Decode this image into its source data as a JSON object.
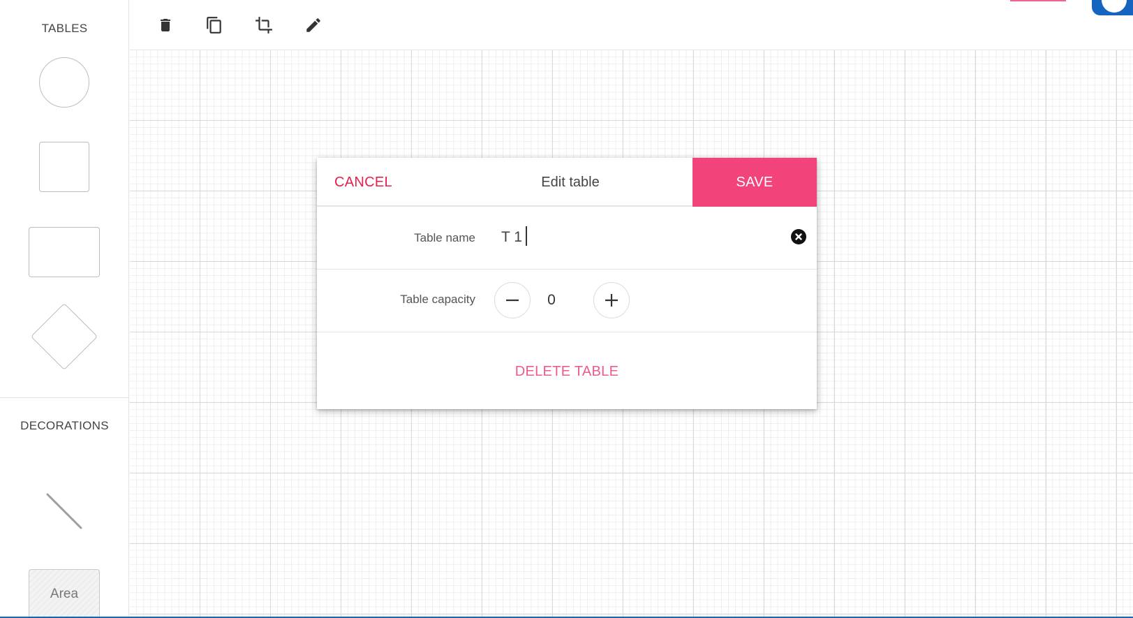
{
  "sidebar": {
    "tables_title": "TABLES",
    "decorations_title": "DECORATIONS",
    "area_label": "Area"
  },
  "toolbar": {
    "tools": [
      "trash-icon",
      "copy-icon",
      "crop-icon",
      "pencil-icon"
    ]
  },
  "dialog": {
    "cancel_label": "CANCEL",
    "title": "Edit table",
    "save_label": "SAVE",
    "name_label": "Table name",
    "name_value": "T 1",
    "capacity_label": "Table capacity",
    "capacity_value": "0",
    "delete_label": "DELETE TABLE"
  },
  "colors": {
    "accent": "#f2447a",
    "cancel": "#e91e4c",
    "delete": "#ee5a8c",
    "blue": "#1565c0"
  }
}
